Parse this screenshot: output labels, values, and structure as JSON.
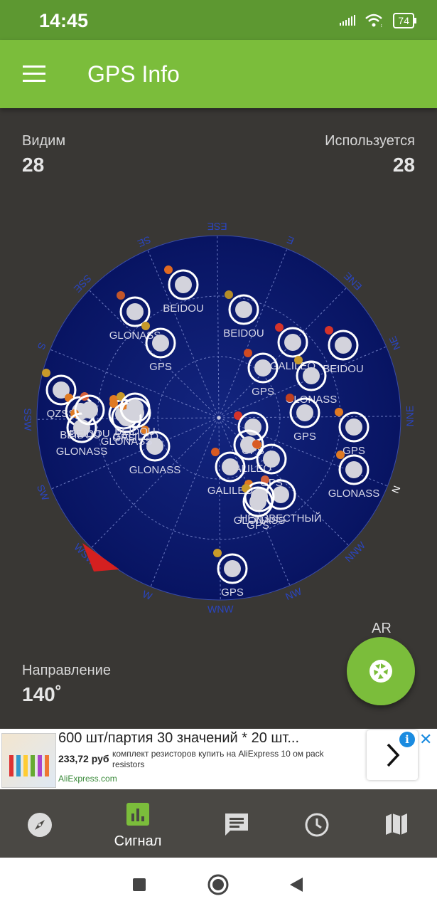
{
  "status_bar": {
    "time": "14:45",
    "battery": "74"
  },
  "app_bar": {
    "title": "GPS Info"
  },
  "stats": {
    "visible_label": "Видим",
    "visible_value": "28",
    "used_label": "Используется",
    "used_value": "28"
  },
  "direction": {
    "label": "Направление",
    "value": "140˚"
  },
  "ar": {
    "label": "AR"
  },
  "compass_labels": [
    "N",
    "NNW",
    "NW",
    "WNW",
    "W",
    "WSW",
    "SW",
    "SSW",
    "S",
    "SSE",
    "SE",
    "ESE",
    "E",
    "ENE",
    "NE",
    "NNE"
  ],
  "satellites": [
    {
      "name": "BEIDOU"
    },
    {
      "name": "GLONASS"
    },
    {
      "name": "GPS"
    },
    {
      "name": "BEIDOU"
    },
    {
      "name": "GALILEO"
    },
    {
      "name": "BEIDOU"
    },
    {
      "name": "GPS"
    },
    {
      "name": "GLONASS"
    },
    {
      "name": "QZSS"
    },
    {
      "name": "BEIDOU"
    },
    {
      "name": "GLONASS"
    },
    {
      "name": "GPS"
    },
    {
      "name": "GALILEO"
    },
    {
      "name": "BEIDOU"
    },
    {
      "name": "GLONASS"
    },
    {
      "name": "GPS"
    },
    {
      "name": "GPS"
    },
    {
      "name": "GPS"
    },
    {
      "name": "GALILEO"
    },
    {
      "name": "GALILEO"
    },
    {
      "name": "GPS"
    },
    {
      "name": "НЕИЗВЕСТНЫЙ"
    },
    {
      "name": "GLONASS"
    },
    {
      "name": "GLONASS"
    },
    {
      "name": "GPS"
    },
    {
      "name": "GPS"
    },
    {
      "name": "GLONASS"
    },
    {
      "name": "BEIDOU"
    }
  ],
  "ad": {
    "title": "600 шт/партия 30 значений * 20 шт...",
    "price": "233,72 руб",
    "description": "комплект резисторов купить на AliExpress 10 ом pack resistors",
    "source": "AliExpress.com"
  },
  "bottom_nav": {
    "items": [
      {
        "icon": "compass-icon",
        "label": ""
      },
      {
        "icon": "signal-chart-icon",
        "label": "Сигнал"
      },
      {
        "icon": "message-icon",
        "label": ""
      },
      {
        "icon": "clock-icon",
        "label": ""
      },
      {
        "icon": "map-icon",
        "label": ""
      }
    ]
  },
  "colors": {
    "status_bar": "#5d9831",
    "app_bar": "#7bbd3b",
    "sky": "#0a1a6b",
    "background": "#393734"
  }
}
